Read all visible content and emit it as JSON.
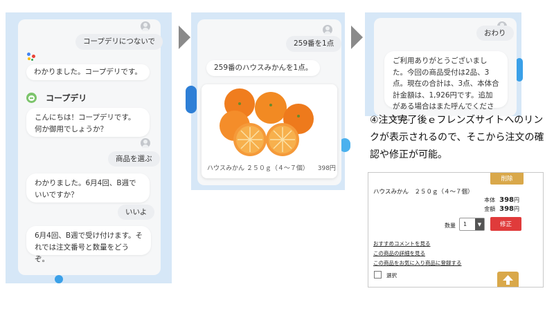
{
  "panel1": {
    "user_msg_1": "コープデリにつないで",
    "assistant_msg_1": "わかりました。コープデリです。",
    "service_name": "コープデリ",
    "coop_msg_1": "こんにちは！コープデリです。何か御用でしょうか？",
    "user_msg_2": "商品を選ぶ",
    "coop_msg_2": "わかりました。6月4回、B週でいいですか？",
    "user_msg_3": "いいよ",
    "coop_msg_3": "6月4回、B週で受け付けます。それでは注文番号と数量をどうぞ。"
  },
  "panel2": {
    "user_msg": "259番を1点",
    "coop_msg": "259番のハウスみかんを1点。",
    "product": {
      "name": "ハウスみかん ２５０ｇ（４〜７個）",
      "price": "398円"
    }
  },
  "panel3": {
    "user_msg": "おわり",
    "coop_msg": "ご利用ありがとうございました。今回の商品受付は2品、3点。現在の合計は、3点、本体合計金額は、1,926円です。追加がある場合はまた呼んでくださいね。"
  },
  "caption": "④注文完了後ｅフレンズサイトへのリンクが表示されるので、そこから注文の確認や修正が可能。",
  "web": {
    "delete_label": "削除",
    "product_name": "ハウスみかん　２５０ｇ（４〜７個）",
    "price_label": "本体",
    "price_value": "398",
    "price_unit": "円",
    "total_label": "金額",
    "total_value": "398",
    "total_unit": "円",
    "qty_label": "数量",
    "qty_value": "1",
    "fix_label": "修正",
    "link_1": "おすすめコメントを見る",
    "link_2": "この商品の詳細を見る",
    "link_3": "この商品をお気に入り商品に登録する",
    "select_label": "選択"
  },
  "colors": {
    "panel_bg": "#d6e7f7",
    "accent_blue": "#2e86de",
    "delete_button": "#d9a84a",
    "fix_button": "#e03b3b"
  },
  "icons": [
    "user-avatar-icon",
    "google-assistant-icon",
    "coop-logo-icon",
    "chevron-right-icon",
    "arrow-up-icon"
  ]
}
